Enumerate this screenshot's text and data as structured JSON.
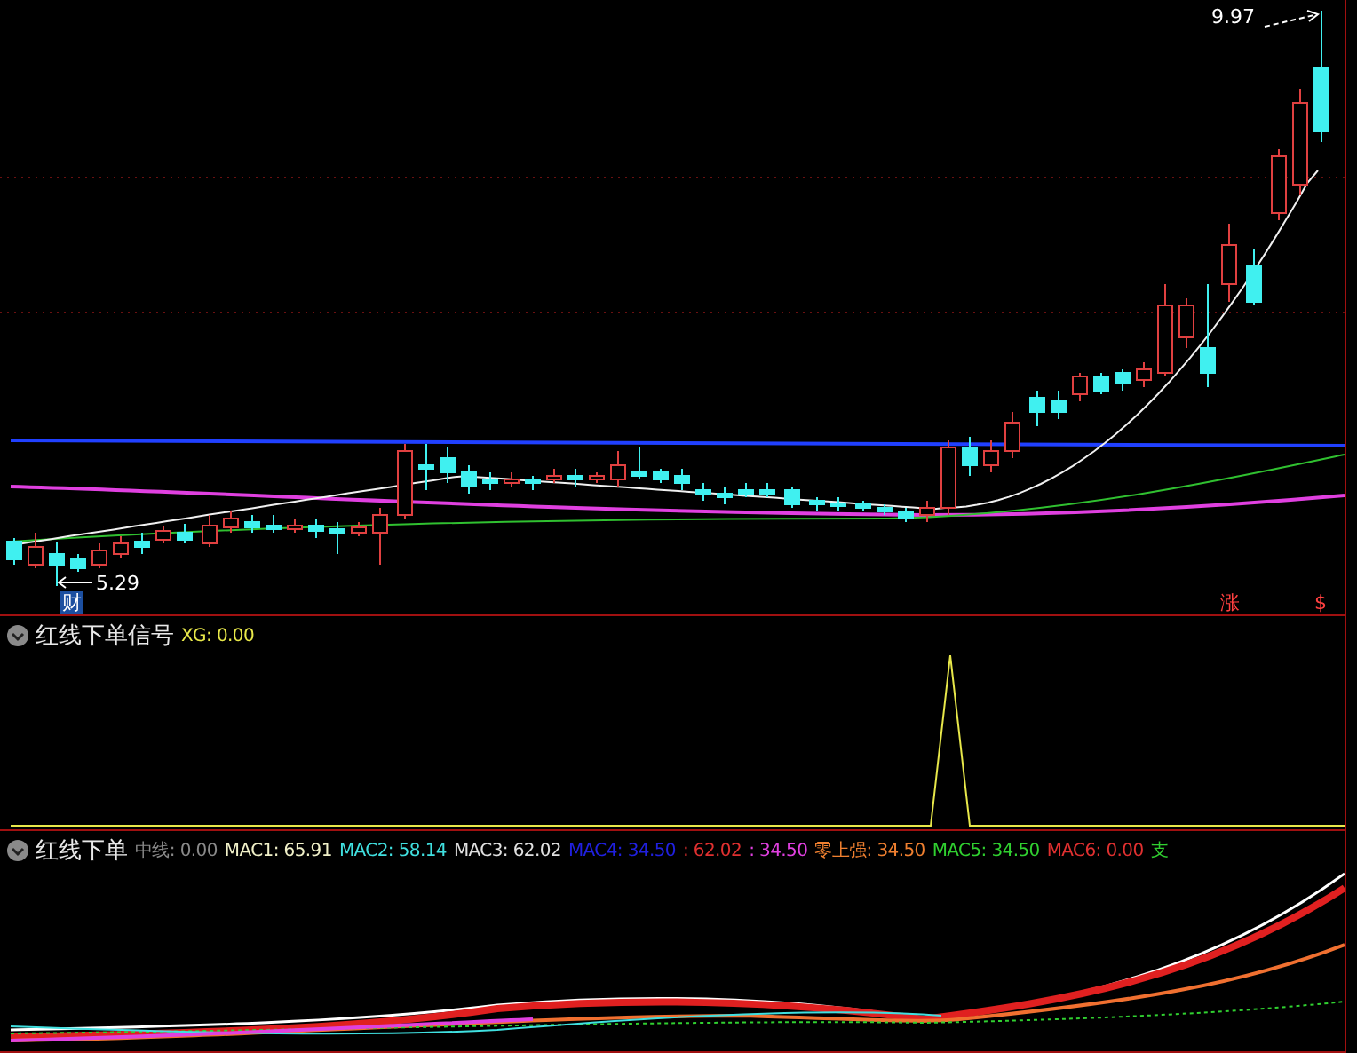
{
  "main_chart": {
    "high_label": "9.97",
    "low_label": "5.29",
    "markers": [
      {
        "text": "财",
        "kind": "tag"
      },
      {
        "text": "涨",
        "kind": "plain"
      },
      {
        "text": "$",
        "kind": "plain"
      }
    ]
  },
  "signal_panel": {
    "title": "红线下单信号",
    "legend": [
      {
        "text": "XG: 0.00",
        "color": "#e8e84a"
      }
    ]
  },
  "indicator_panel": {
    "title": "红线下单",
    "legend": [
      {
        "text": "中线: 0.00",
        "color": "#8a8a8a"
      },
      {
        "text": "MAC1: 65.91",
        "color": "#f0f0c8"
      },
      {
        "text": "MAC2: 58.14",
        "color": "#40e0e0"
      },
      {
        "text": "MAC3: 62.02",
        "color": "#e0e0e0"
      },
      {
        "text": "MAC4: 34.50",
        "color": "#2020e0"
      },
      {
        "text": ": 62.02",
        "color": "#e03030"
      },
      {
        "text": ": 34.50",
        "color": "#e040e0"
      },
      {
        "text": "零上强: 34.50",
        "color": "#f08030"
      },
      {
        "text": "MAC5: 34.50",
        "color": "#30d030"
      },
      {
        "text": "MAC6: 0.00",
        "color": "#e03030"
      },
      {
        "text": "支",
        "color": "#30d030"
      }
    ]
  }
}
